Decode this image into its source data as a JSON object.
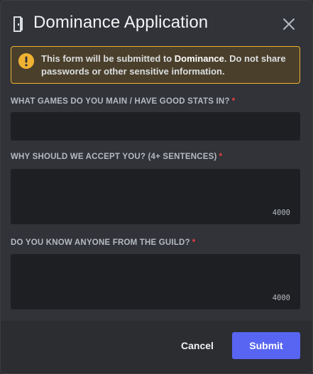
{
  "modal": {
    "title": "Dominance Application",
    "app_icon": "door-icon",
    "close_icon": "close-icon"
  },
  "notice": {
    "icon": "warning-icon",
    "text_before": "This form will be submitted to ",
    "server_name": "Dominance",
    "text_after": ". Do not share passwords or other sensitive information.",
    "accent_color": "#f0b232"
  },
  "fields": [
    {
      "label": "WHAT GAMES DO YOU MAIN / HAVE GOOD STATS IN?",
      "required_mark": "*",
      "value": ""
    },
    {
      "label": "WHY SHOULD WE ACCEPT YOU? (4+ SENTENCES)",
      "required_mark": "*",
      "value": "",
      "char_counter": "4000"
    },
    {
      "label": "DO YOU KNOW ANYONE FROM THE GUILD?",
      "required_mark": "*",
      "value": "",
      "char_counter": "4000"
    }
  ],
  "footer": {
    "cancel_label": "Cancel",
    "submit_label": "Submit",
    "submit_color": "#5865f2"
  }
}
